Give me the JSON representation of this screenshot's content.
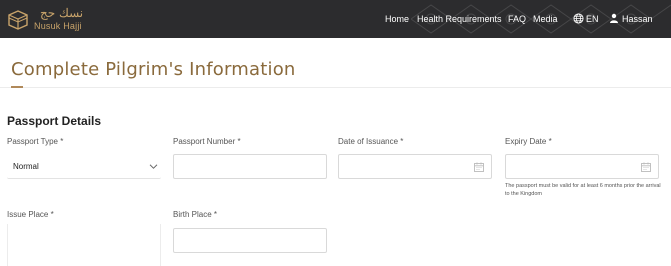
{
  "brand": {
    "name_ar": "نسك حج",
    "name_en": "Nusuk Hajji"
  },
  "nav": {
    "items": [
      {
        "label": "Home"
      },
      {
        "label": "Health Requirements"
      },
      {
        "label": "FAQ"
      },
      {
        "label": "Media"
      }
    ],
    "language": "EN",
    "user": "Hassan"
  },
  "page": {
    "title": "Complete Pilgrim's Information"
  },
  "section": {
    "title": "Passport Details"
  },
  "form": {
    "passport_type": {
      "label": "Passport Type *",
      "value": "Normal"
    },
    "passport_number": {
      "label": "Passport Number *",
      "value": ""
    },
    "date_of_issuance": {
      "label": "Date of Issuance *",
      "value": ""
    },
    "expiry_date": {
      "label": "Expiry Date *",
      "value": "",
      "hint": "The passport must be valid for at least 6 months prior the arrival to the Kingdom"
    },
    "issue_place": {
      "label": "Issue Place *",
      "value": ""
    },
    "birth_place": {
      "label": "Birth Place *",
      "value": ""
    }
  },
  "colors": {
    "topbar": "#2c2c2e",
    "brand_gold": "#c8a36a",
    "title_brown": "#8a6a3c"
  },
  "icons": [
    "kaaba-emblem-icon",
    "globe-icon",
    "user-icon",
    "chevron-down-icon",
    "calendar-icon"
  ]
}
